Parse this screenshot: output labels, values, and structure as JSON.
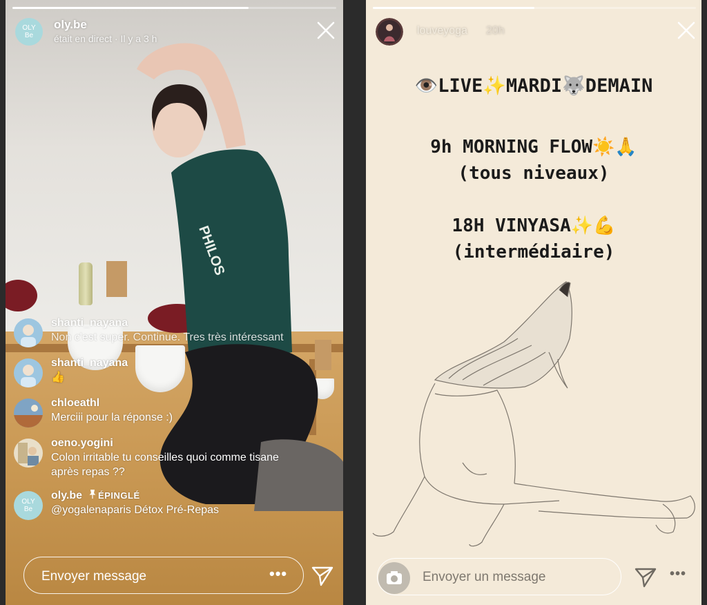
{
  "left_story": {
    "username": "oly.be",
    "avatar_text_top": "OLY",
    "avatar_text_bottom": "Be",
    "subtitle": "était en direct · Il y a 3 h",
    "progress": 0.73,
    "comments": [
      {
        "user": "shanti_nayana",
        "text": "Non c'est super. Continue. Tres très intéressant"
      },
      {
        "user": "shanti_nayana",
        "text": "👍"
      },
      {
        "user": "chloeathl",
        "text": "Merciii pour la réponse :)"
      },
      {
        "user": "oeno.yogini",
        "text": "Colon irritable tu conseilles quoi comme tisane après repas ??"
      }
    ],
    "pinned": {
      "user": "oly.be",
      "pin_icon": "pin-icon",
      "label": "ÉPINGLÉ",
      "mention": "@yogalenaparis",
      "text": "Détox Pré-Repas"
    },
    "message_placeholder": "Envoyer message",
    "more_label": "•••",
    "accent_avatar_color": "#a9d9dd"
  },
  "right_story": {
    "username": "louveyoga",
    "time": "20h",
    "progress": 0.5,
    "lines": [
      "👁️LIVE✨MARDI🐺DEMAIN",
      "9h MORNING FLOW☀️🙏",
      "(tous niveaux)",
      "18H VINYASA✨💪",
      "(intermédiaire)"
    ],
    "message_placeholder": "Envoyer un message",
    "more_label": "•••",
    "background_color": "#f4ead9"
  }
}
